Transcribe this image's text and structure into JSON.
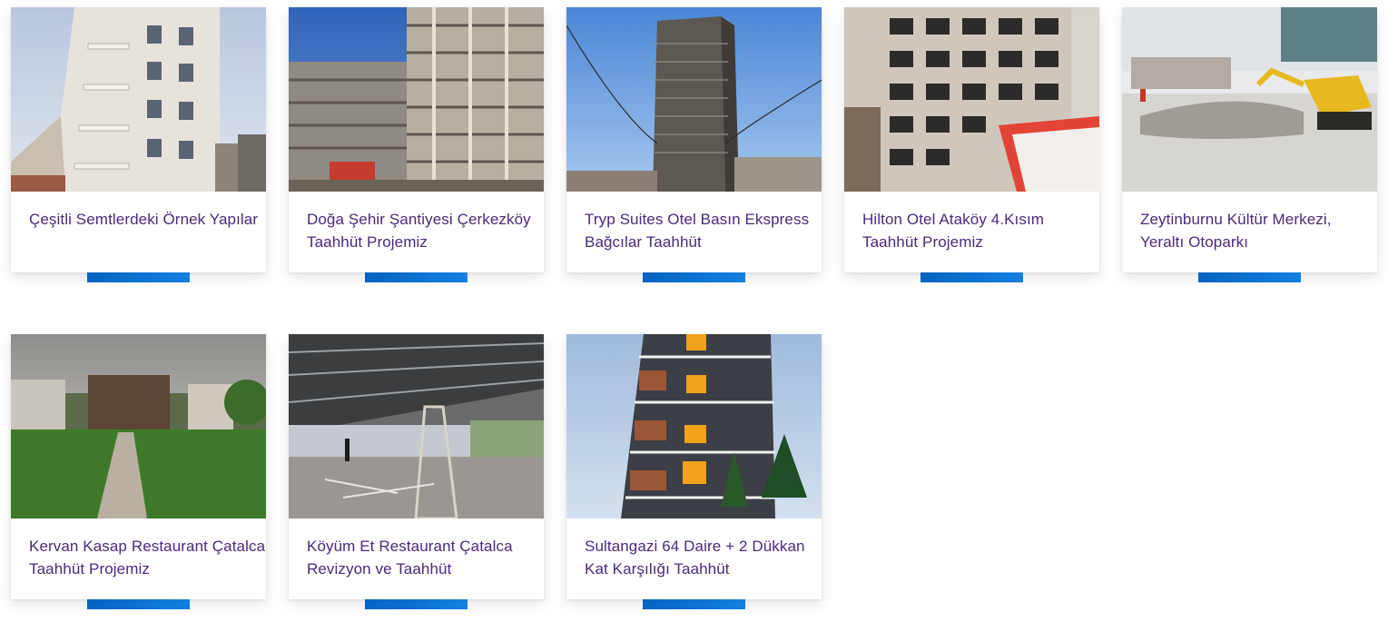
{
  "projects": [
    {
      "title": "Çeşitli Semtlerdeki Örnek Yapılar",
      "image": "white-residential-building-photo"
    },
    {
      "title": "Doğa Şehir Şantiyesi Çerkezköy\nTaahhüt Projemiz",
      "image": "concrete-frame-construction-photo"
    },
    {
      "title": "Tryp Suites Otel Basın Ekspress\nBağcılar Taahhüt",
      "image": "highrise-tower-construction-photo"
    },
    {
      "title": "Hilton Otel Ataköy 4.Kısım\nTaahhüt Projemiz",
      "image": "hotel-facade-construction-photo"
    },
    {
      "title": "Zeytinburnu Kültür Merkezi,\nYeraltı Otoparkı",
      "image": "excavator-demolition-site-photo"
    },
    {
      "title": "Kervan Kasap Restaurant Çatalca\nTaahhüt Projemiz",
      "image": "restaurant-garden-path-photo"
    },
    {
      "title": "Köyüm Et Restaurant Çatalca\nRevizyon ve Taahhüt",
      "image": "restaurant-interior-renovation-photo"
    },
    {
      "title": "Sultangazi 64 Daire + 2 Dükkan\nKat Karşılığı Taahhüt",
      "image": "apartment-tower-facade-photo"
    }
  ],
  "colors": {
    "title_text": "#4b2a7b",
    "accent_bar": "#0563c2"
  }
}
